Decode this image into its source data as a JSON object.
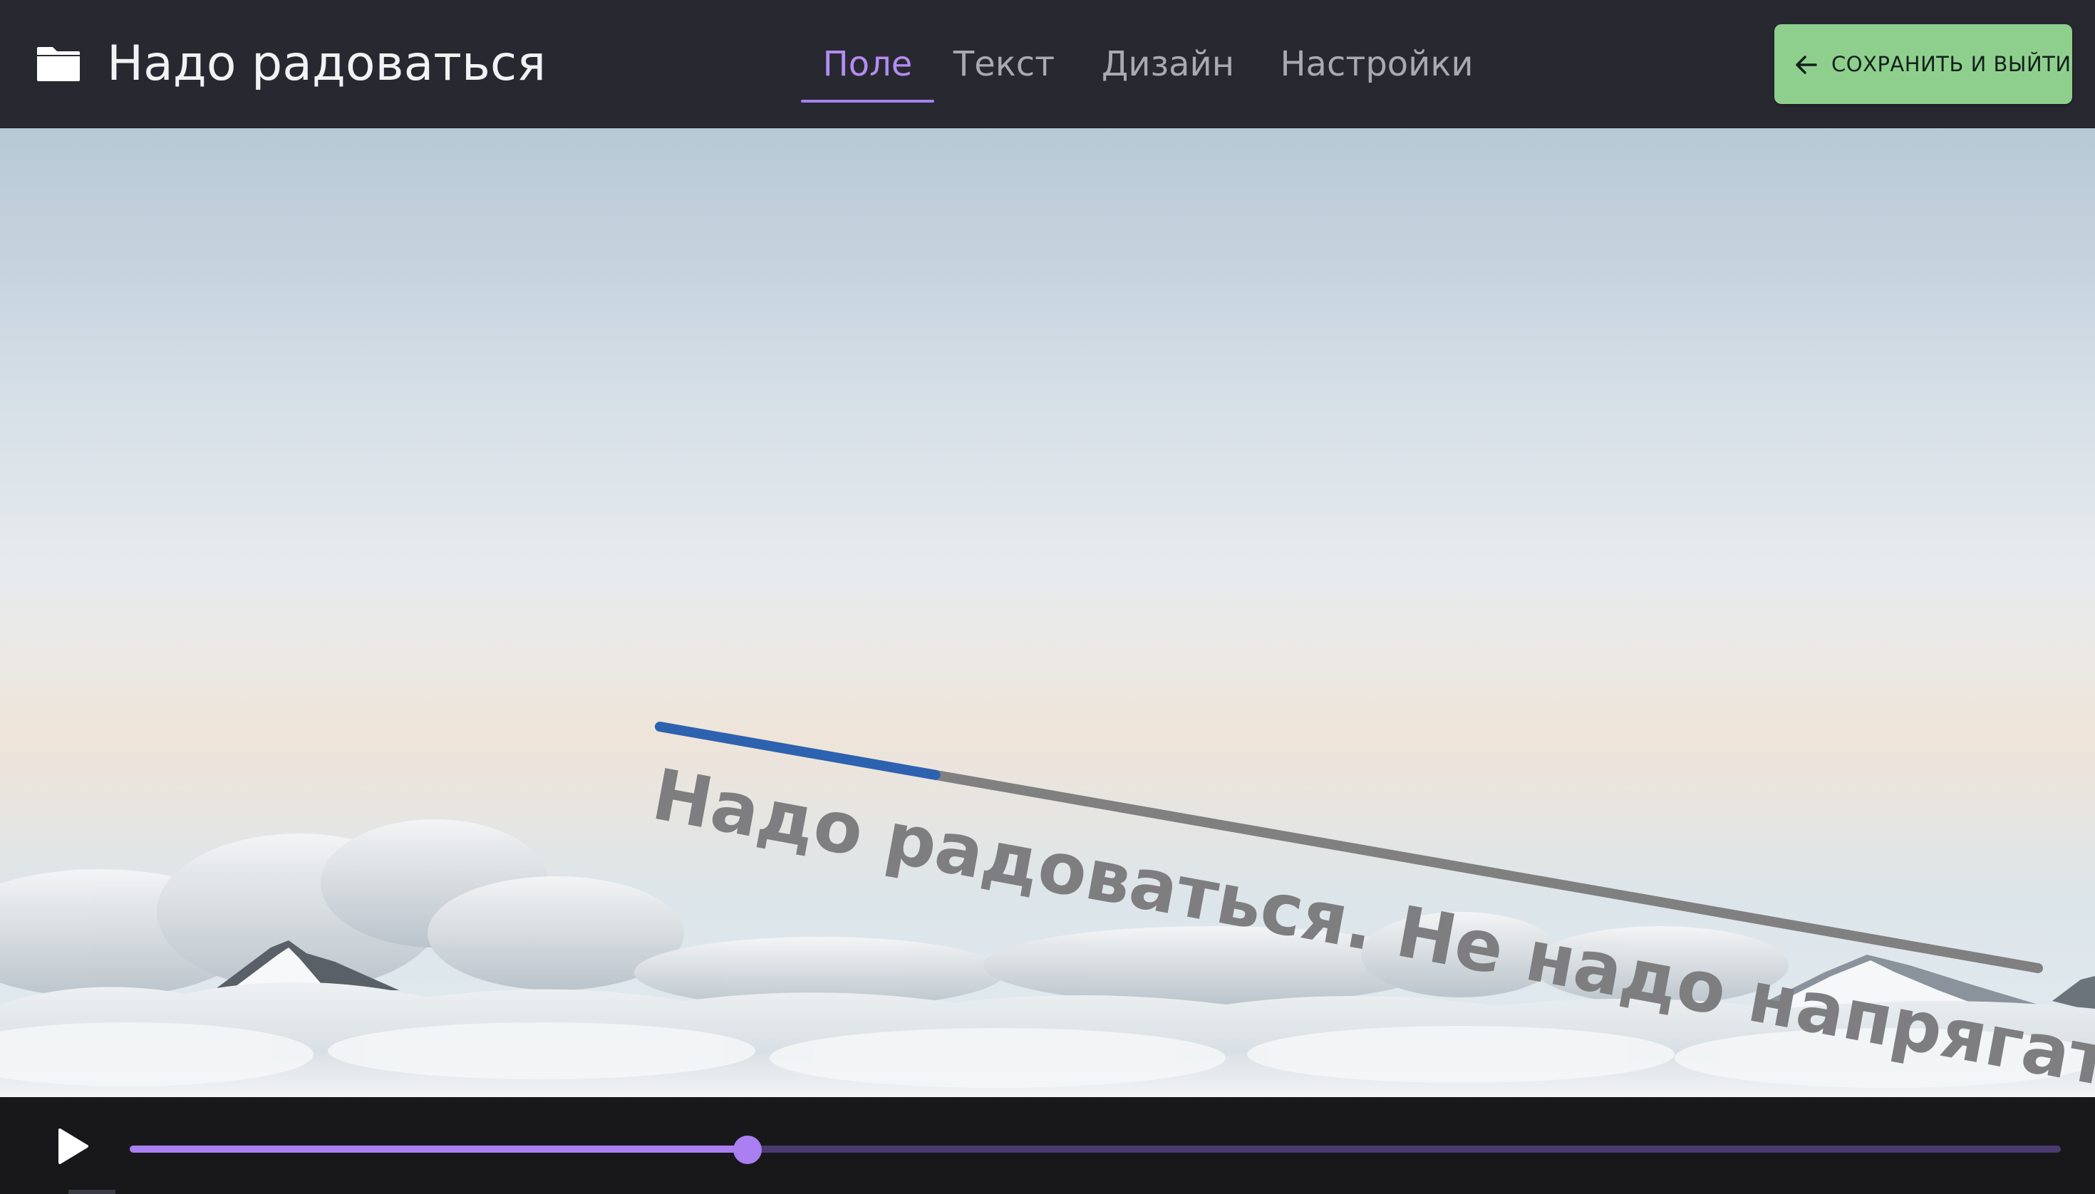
{
  "header": {
    "title": "Надо радоваться",
    "folder_icon": "folder-icon",
    "tabs": [
      {
        "label": "Поле",
        "active": true
      },
      {
        "label": "Текст",
        "active": false
      },
      {
        "label": "Дизайн",
        "active": false
      },
      {
        "label": "Настройки",
        "active": false
      }
    ],
    "save_label": "СОХРАНИТЬ И ВЫЙТИ",
    "save_icon": "arrow-left-icon"
  },
  "canvas": {
    "caption": "Надо радоваться. Не надо напрягаться.",
    "path_progress": 0.2
  },
  "player": {
    "play_icon": "play-icon",
    "progress": 0.32
  },
  "colors": {
    "accent": "#a97ff1",
    "save_button": "#8fcf8e",
    "path_done": "#2d62b0",
    "path_rest": "#808080"
  }
}
